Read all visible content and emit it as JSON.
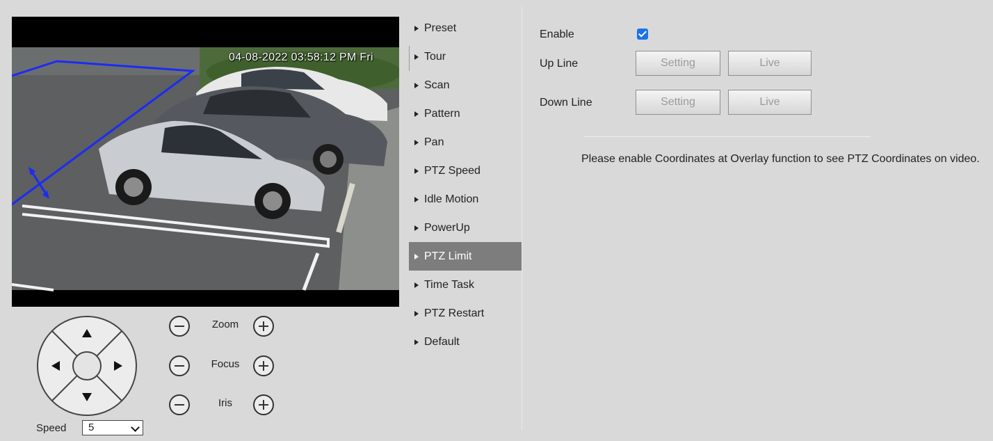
{
  "video": {
    "timestamp": "04-08-2022 03:58:12 PM Fri"
  },
  "ptz_controls": {
    "lens": [
      {
        "label": "Zoom"
      },
      {
        "label": "Focus"
      },
      {
        "label": "Iris"
      }
    ],
    "speed_label": "Speed",
    "speed_value": "5"
  },
  "menu": {
    "items": [
      {
        "label": "Preset"
      },
      {
        "label": "Tour"
      },
      {
        "label": "Scan"
      },
      {
        "label": "Pattern"
      },
      {
        "label": "Pan"
      },
      {
        "label": "PTZ Speed"
      },
      {
        "label": "Idle Motion"
      },
      {
        "label": "PowerUp"
      },
      {
        "label": "PTZ Limit",
        "active": true
      },
      {
        "label": "Time Task"
      },
      {
        "label": "PTZ Restart"
      },
      {
        "label": "Default"
      }
    ]
  },
  "ptz_limit": {
    "enable_label": "Enable",
    "enable_checked": true,
    "up_line_label": "Up Line",
    "down_line_label": "Down Line",
    "setting_label": "Setting",
    "live_label": "Live",
    "note": "Please enable Coordinates at Overlay function to see PTZ Coordinates on video."
  },
  "colors": {
    "accent": "#1a73e8",
    "active_menu": "#7d7d7d",
    "background": "#d9d9d9"
  }
}
